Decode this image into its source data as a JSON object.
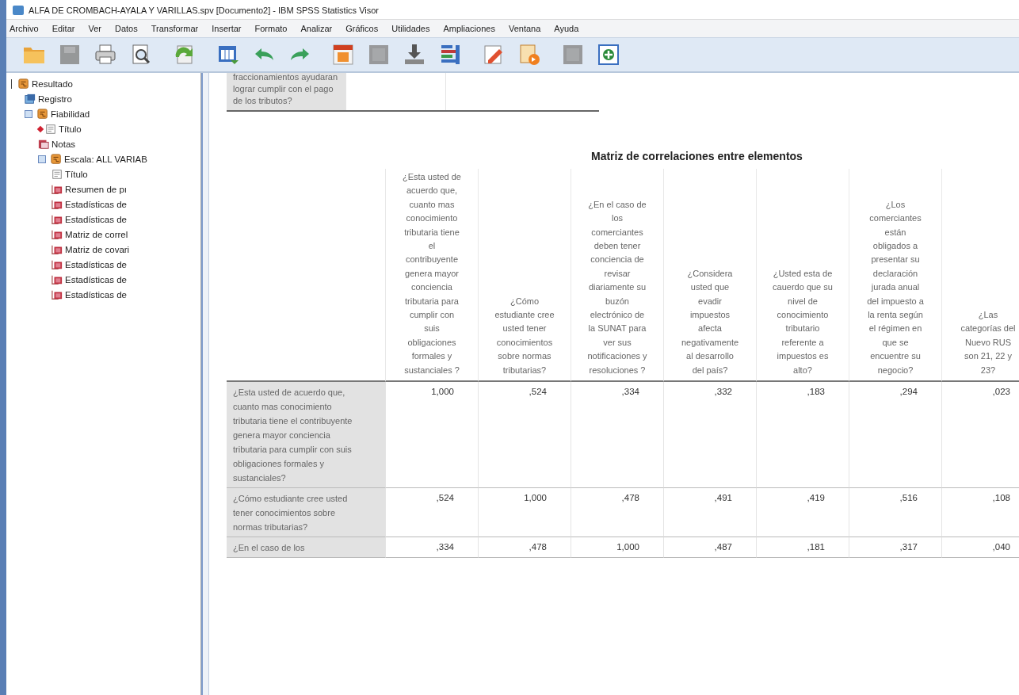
{
  "window": {
    "title": "ALFA DE CROMBACH-AYALA Y VARILLAS.spv [Documento2] - IBM SPSS Statistics Visor"
  },
  "menu": [
    "Archivo",
    "Editar",
    "Ver",
    "Datos",
    "Transformar",
    "Insertar",
    "Formato",
    "Analizar",
    "Gráficos",
    "Utilidades",
    "Ampliaciones",
    "Ventana",
    "Ayuda"
  ],
  "toolbar": [
    {
      "kind": "folder"
    },
    {
      "kind": "save",
      "disabled": true
    },
    {
      "kind": "print"
    },
    {
      "kind": "preview"
    },
    {
      "kind": "export"
    },
    {
      "kind": "dataset"
    },
    {
      "kind": "undo"
    },
    {
      "kind": "redo"
    },
    {
      "kind": "goto"
    },
    {
      "kind": "blank",
      "disabled": true
    },
    {
      "kind": "download"
    },
    {
      "kind": "variables"
    },
    {
      "kind": "pencil"
    },
    {
      "kind": "docarrow"
    },
    {
      "kind": "blank",
      "disabled": true
    },
    {
      "kind": "add"
    }
  ],
  "outline": [
    {
      "label": "Resultado",
      "kind": "folder",
      "children": [
        {
          "label": "Registro",
          "kind": "log"
        },
        {
          "label": "Fiabilidad",
          "kind": "folder",
          "expanded": true,
          "children": [
            {
              "label": "Título",
              "kind": "title",
              "current": true
            },
            {
              "label": "Notas",
              "kind": "notes"
            },
            {
              "label": "Escala: ALL VARIAB",
              "kind": "folder",
              "expanded": true,
              "children": [
                {
                  "label": "Título",
                  "kind": "title"
                },
                {
                  "label": "Resumen de pı",
                  "kind": "table"
                },
                {
                  "label": "Estadísticas de",
                  "kind": "table"
                },
                {
                  "label": "Estadísticas de",
                  "kind": "table"
                },
                {
                  "label": "Matriz de correl",
                  "kind": "table"
                },
                {
                  "label": "Matriz de covari",
                  "kind": "table"
                },
                {
                  "label": "Estadísticas de",
                  "kind": "table"
                },
                {
                  "label": "Estadísticas de",
                  "kind": "table"
                },
                {
                  "label": "Estadísticas de",
                  "kind": "table"
                }
              ]
            }
          ]
        }
      ]
    }
  ],
  "previous_table": {
    "row_label": "fraccionamientos ayudaran lograr cumplir con el pago de los tributos?"
  },
  "table": {
    "title": "Matriz de correlaciones entre elementos",
    "columns": [
      "¿Esta usted de acuerdo que, cuanto mas conocimiento tributaria tiene  el contribuyente genera mayor conciencia tributaria para cumplir con suis obligaciones formales y sustanciales ?",
      "¿Cómo estudiante cree usted tener conocimientos sobre normas tributarias?",
      "¿En el caso de los comerciantes deben tener conciencia de revisar diariamente su buzón electrónico de la SUNAT para ver sus notificaciones y resoluciones ?",
      "¿Considera usted que evadir impuestos afecta negativamente al desarrollo del país?",
      "¿Usted esta de cauerdo que su nivel de conocimiento tributario referente a impuestos es alto?",
      "¿Los comerciantes están obligados a presentar su declaración jurada anual del impuesto a la renta según el régimen en que se encuentre su negocio?",
      "¿Las categorías del Nuevo RUS son 21, 22 y 23?"
    ],
    "rows": [
      {
        "label": "¿Esta usted de acuerdo que, cuanto mas conocimiento tributaria tiene  el contribuyente genera mayor conciencia tributaria para cumplir con suis obligaciones formales y sustanciales?",
        "values": [
          "1,000",
          ",524",
          ",334",
          ",332",
          ",183",
          ",294",
          ",023"
        ]
      },
      {
        "label": "¿Cómo estudiante cree usted tener conocimientos sobre normas tributarias?",
        "values": [
          ",524",
          "1,000",
          ",478",
          ",491",
          ",419",
          ",516",
          ",108"
        ]
      },
      {
        "label": "¿En el caso de los",
        "values": [
          ",334",
          ",478",
          "1,000",
          ",487",
          ",181",
          ",317",
          ",040"
        ]
      }
    ]
  }
}
